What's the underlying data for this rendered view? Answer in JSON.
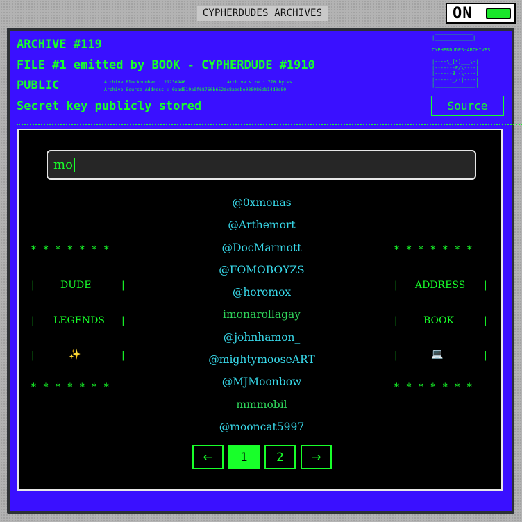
{
  "window": {
    "title": "CYPHERDUDES ARCHIVES",
    "power_label": "ON"
  },
  "header": {
    "archive": "ARCHIVE #119",
    "file": "FILE #1 emitted by BOOK - CYPHERDUDE #1910",
    "visibility": "PUBLIC",
    "status": "Secret key publicly stored",
    "block_number": "Archive Blocknumber : 21230946",
    "archive_size": "Archive size : 770 bytes",
    "source_address": "Archive Source Address : 0xad519a0f68760b652dc8aeebe038086ab14d3c80",
    "ascii_art": " _____________\n|_____________|\n\nCYPHERDUDES-ARCHIVES\n _____________\n|----\\_[*]___\\-|\n|-------F/\\----|\n|------3_-\\----|\n|------_/-|----|\n|______________|",
    "source_button": "Source"
  },
  "search": {
    "value": "mo"
  },
  "results": [
    "@0xmonas",
    "@Arthemort",
    "@DocMarmott",
    "@FOMOBOYZS",
    "@horomox",
    "imonarollagay",
    "@johnhamon_",
    "@mightymooseART",
    "@MJMoonbow",
    "mmmobil",
    "@mooncat5997"
  ],
  "left_box": {
    "stars": "* * * * * * *",
    "line1": "DUDE",
    "line2": "LEGENDS",
    "icon": "✨",
    "icon_name": "sparkles-icon",
    "bar": "|"
  },
  "right_box": {
    "stars": "* * * * * * *",
    "line1": "ADDRESS",
    "line2": "BOOK",
    "icon": "💻",
    "icon_name": "laptop-icon",
    "bar": "|"
  },
  "pagination": {
    "prev": "←",
    "pages": [
      "1",
      "2"
    ],
    "current": "1",
    "next": "→"
  },
  "colors": {
    "panel": "#3a10ff",
    "accent_green": "#18ff2a",
    "handle_cyan": "#38d9ea"
  }
}
